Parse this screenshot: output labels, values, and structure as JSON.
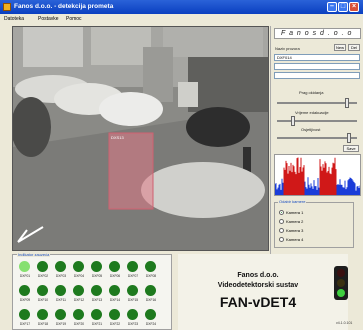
{
  "window": {
    "title": "Fanos d.o.o. - detekcija prometa"
  },
  "menu": {
    "items": [
      "Datoteka",
      "Postavke",
      "Pomoc"
    ]
  },
  "video": {
    "zone_label": "DXS13"
  },
  "panel": {
    "brand": "F a n o s   d . o . o",
    "zone_name_label": "Naziv prozora",
    "new_label": "New",
    "delete_label": "Del",
    "zone_value": "DXF014",
    "slider_threshold": "Prag okidanja",
    "slider_time": "Vrijeme edakuacije",
    "slider_sensitivity": "Osjetljivost",
    "save_label": "Save"
  },
  "cameras": {
    "title": "Odabir kamere",
    "items": [
      "Kamera 1",
      "Kamera 2",
      "Kamera 3",
      "Kamera 4"
    ],
    "selected_index": 0
  },
  "indicators": {
    "title": "Indikator zauzeća",
    "labels": [
      "DXF01",
      "DXF02",
      "DXF03",
      "DXF04",
      "DXF05",
      "DXF06",
      "DXF07",
      "DXF08",
      "DXF09",
      "DXF10",
      "DXF11",
      "DXF12",
      "DXF13",
      "DXF14",
      "DXF15",
      "DXF16",
      "DXF17",
      "DXF18",
      "DXF19",
      "DXF20",
      "DXF21",
      "DXF22",
      "DXF23",
      "DXF24"
    ],
    "active_index": 0
  },
  "logo": {
    "line1": "Fanos d.o.o.",
    "line2": "Videodetektorski sustav",
    "line3": "FAN-vDET4"
  },
  "version": "v4.1.0.101",
  "colors": {
    "dot_active": "#86e070",
    "dot_inactive": "#1e7a1e",
    "title_bar": "#0a3fc0"
  }
}
